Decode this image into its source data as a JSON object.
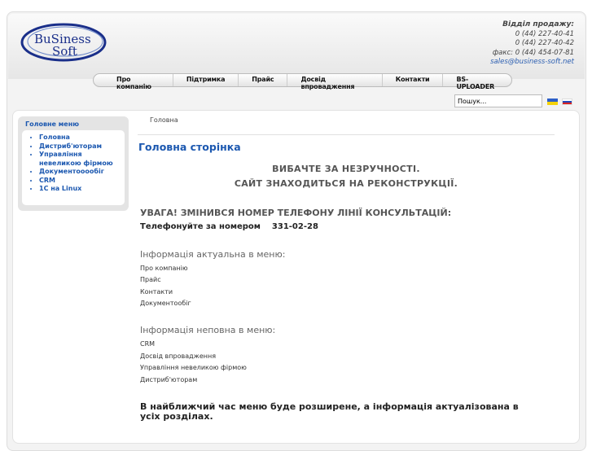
{
  "logo": {
    "text1": "BuSiness",
    "text2": "Soft"
  },
  "contacts": {
    "title": "Відділ продажу:",
    "phone1": "0 (44) 227-40-41",
    "phone2": "0 (44) 227-40-42",
    "fax": "факс: 0 (44) 454-07-81",
    "email": "sales@business-soft.net"
  },
  "nav": [
    "Про компанію",
    "Підтримка",
    "Прайс",
    "Досвід впровадження",
    "Контакти",
    "BS-UPLOADER"
  ],
  "search": {
    "value": "Пошук..."
  },
  "sidebar": {
    "title": "Головне меню",
    "items": [
      "Головна",
      "Дистриб'юторам",
      "Управління невеликою фірмою",
      "Документооообіг",
      "CRM",
      "1С на Linux"
    ]
  },
  "breadcrumb": "Головна",
  "main": {
    "title": "Головна сторінка",
    "notice1": "ВИБАЧТЕ ЗА НЕЗРУЧНОСТІ.",
    "notice2": "САЙТ ЗНАХОДИТЬСЯ НА РЕКОНСТРУКЦІЇ.",
    "warning": "УВАГА! ЗМІНИВСЯ НОМЕР ТЕЛЕФОНУ ЛІНІЇ КОНСУЛЬТАЦІЙ:",
    "call": "Телефонуйте за номером    331-02-28",
    "actual_title": "Інформація актуальна в меню:",
    "actual": [
      "Про компанію",
      "Прайс",
      "Контакти",
      "Документообіг"
    ],
    "partial_title": "Інформація неповна в меню:",
    "partial": [
      "CRM",
      "Досвід впровадження",
      "Управління невеликою фірмою",
      "Дистриб'юторам"
    ],
    "footer_note": "В найближчий час меню буде розширене, а інформація актуалізована в усіх розділах."
  }
}
